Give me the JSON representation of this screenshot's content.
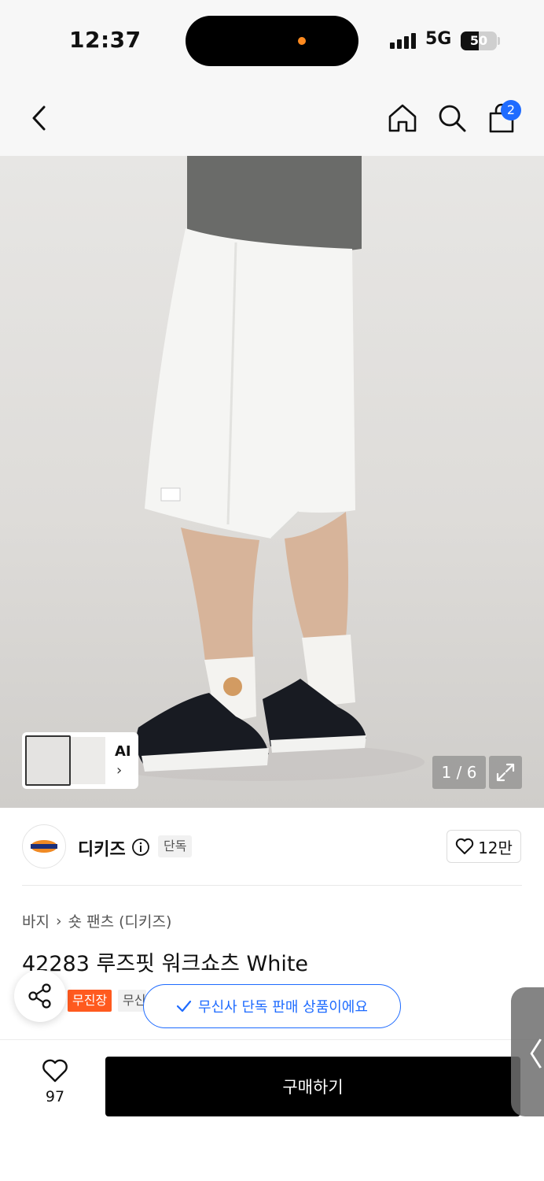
{
  "status_bar": {
    "time": "12:37",
    "network": "5G",
    "battery": "50",
    "battery_level": 0.5,
    "island_dot_color": "#ff8a1f"
  },
  "nav": {
    "back_icon": "chevron-left-icon",
    "home_icon": "home-icon",
    "search_icon": "search-icon",
    "cart_icon": "shopping-bag-icon",
    "cart_count": "2"
  },
  "gallery": {
    "ai_label": "AI",
    "ai_chevron": "›",
    "counter": "1 / 6",
    "expand_icon": "expand-icon"
  },
  "brand": {
    "name": "디키즈",
    "exclusive_badge": "단독",
    "like_count": "12만"
  },
  "product": {
    "breadcrumb": [
      "바지",
      "숏 팬츠 (디키즈)"
    ],
    "title": "42283 루즈핏 워크쇼츠 White",
    "tag_free_shipping": "무진장",
    "tag_musinsa": "무신사",
    "toast": "무신사 단독 판매 상품이에요"
  },
  "bottom_bar": {
    "wish_count": "97",
    "buy_label": "구매하기",
    "side_handle": "〈"
  },
  "colors": {
    "accent_blue": "#1e6bff",
    "tag_orange": "#ff5a1f",
    "buy_button": "#000000"
  }
}
